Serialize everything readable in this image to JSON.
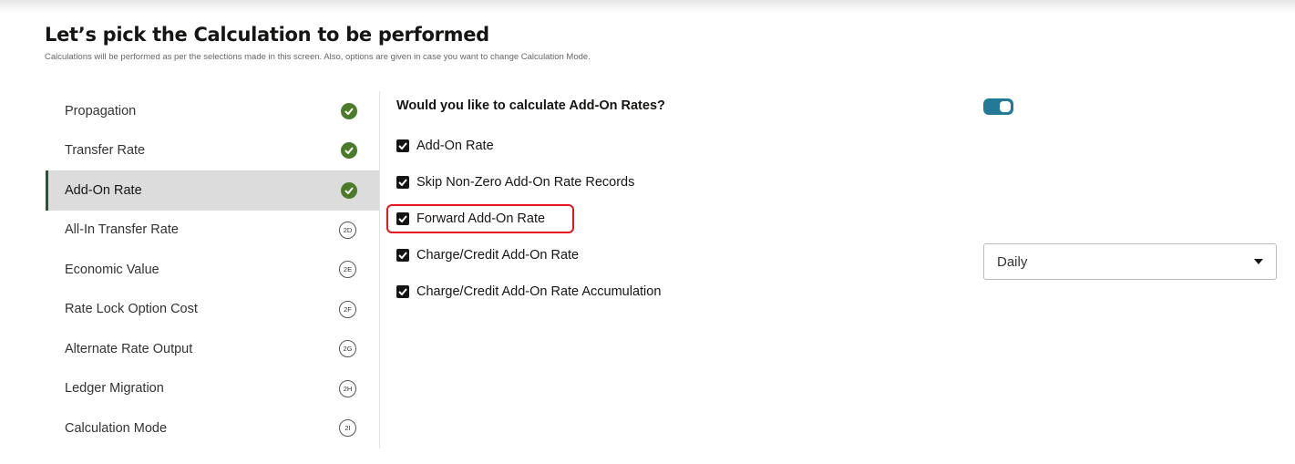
{
  "header": {
    "title": "Let’s pick the Calculation to be performed",
    "subtitle": "Calculations will be performed as per the selections made in this screen. Also, options are given in case you want to change Calculation Mode."
  },
  "sidebar": {
    "items": [
      {
        "label": "Propagation",
        "status": "complete"
      },
      {
        "label": "Transfer Rate",
        "status": "complete"
      },
      {
        "label": "Add-On Rate",
        "status": "complete",
        "active": true
      },
      {
        "label": "All-In Transfer Rate",
        "badge": "2D"
      },
      {
        "label": "Economic Value",
        "badge": "2E"
      },
      {
        "label": "Rate Lock Option Cost",
        "badge": "2F"
      },
      {
        "label": "Alternate Rate Output",
        "badge": "2G"
      },
      {
        "label": "Ledger Migration",
        "badge": "2H"
      },
      {
        "label": "Calculation Mode",
        "badge": "2I"
      }
    ]
  },
  "main": {
    "question": "Would you like to calculate Add-On Rates?",
    "toggle_on": true,
    "options": [
      {
        "label": "Add-On Rate",
        "checked": true
      },
      {
        "label": "Skip Non-Zero Add-On Rate Records",
        "checked": true
      },
      {
        "label": "Forward Add-On Rate",
        "checked": true,
        "highlighted": true
      },
      {
        "label": "Charge/Credit Add-On Rate",
        "checked": true
      },
      {
        "label": "Charge/Credit Add-On Rate Accumulation",
        "checked": true
      }
    ],
    "frequency_select": {
      "value": "Daily"
    }
  },
  "colors": {
    "accent": "#227a97",
    "complete": "#4a7a2a",
    "highlight": "#e8161e"
  }
}
